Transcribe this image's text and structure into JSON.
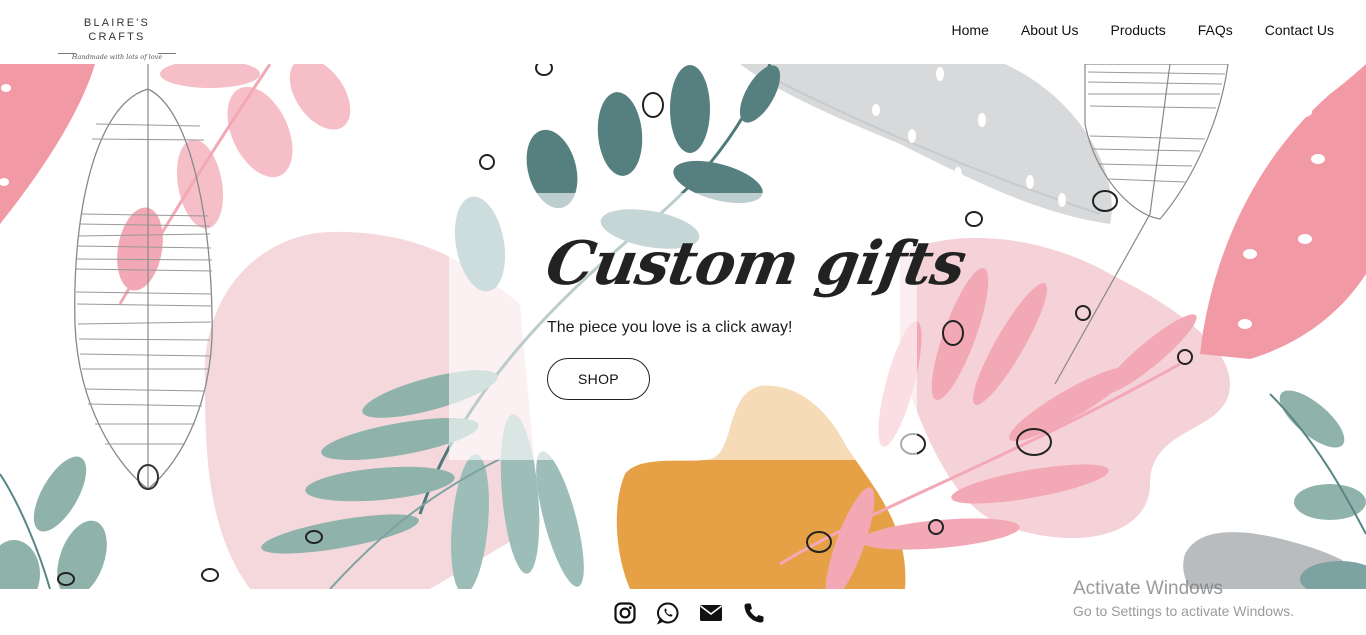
{
  "brand": {
    "name": "BLAIRE'S CRAFTS",
    "tagline": "Handmade with lots of love"
  },
  "nav": {
    "items": [
      {
        "label": "Home"
      },
      {
        "label": "About Us"
      },
      {
        "label": "Products"
      },
      {
        "label": "FAQs"
      },
      {
        "label": "Contact Us"
      }
    ]
  },
  "hero": {
    "title": "Custom gifts",
    "subtitle": "The piece you love is a click away!",
    "cta_label": "SHOP"
  },
  "footer": {
    "icons": [
      "instagram-icon",
      "whatsapp-icon",
      "email-icon",
      "phone-icon"
    ]
  },
  "watermark": {
    "title": "Activate Windows",
    "subtitle": "Go to Settings to activate Windows."
  },
  "colors": {
    "pink": "#f19aa6",
    "light_pink": "#f4d2d8",
    "teal": "#5a8585",
    "sage": "#8fb3ab",
    "gray": "#cfd2d4",
    "orange": "#e6a147"
  }
}
